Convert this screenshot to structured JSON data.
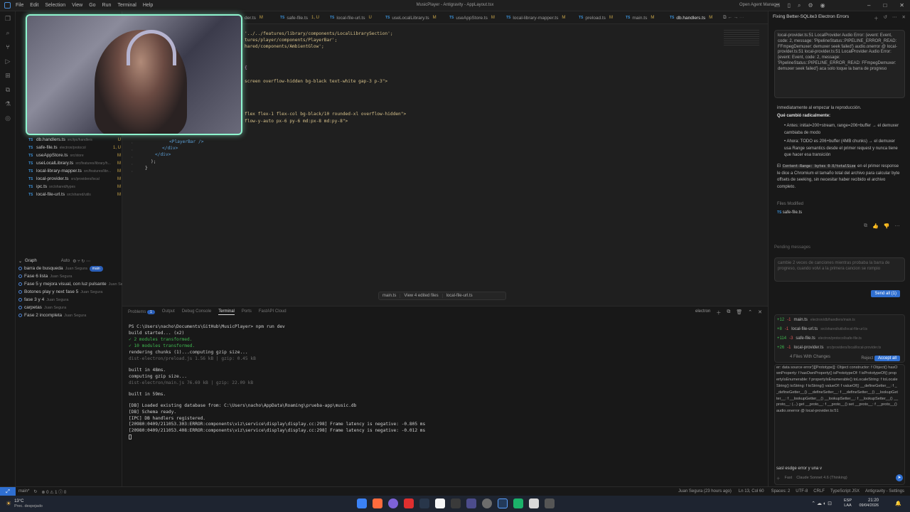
{
  "menubar": {
    "items": [
      "File",
      "Edit",
      "Selection",
      "View",
      "Go",
      "Run",
      "Terminal",
      "Help"
    ],
    "window_title": "MusicPlayer - Antigravity - AppLayout.tsx",
    "agent_manager": "Open Agent Manager"
  },
  "tabs": [
    {
      "name": "der.ts",
      "status": "M"
    },
    {
      "name": "safe-file.ts",
      "status": "1, U"
    },
    {
      "name": "local-file-url.ts",
      "status": "U"
    },
    {
      "name": "useLocalLibrary.ts",
      "status": "M"
    },
    {
      "name": "useAppStore.ts",
      "status": "M"
    },
    {
      "name": "local-library-mapper.ts",
      "status": "M"
    },
    {
      "name": "preload.ts",
      "status": "M"
    },
    {
      "name": "main.ts",
      "status": "M"
    },
    {
      "name": "db.handlers.ts",
      "status": "M"
    }
  ],
  "editor": {
    "lines": [
      {
        "text": "'../../features/library/components/LocalLibrarySection';"
      },
      {
        "text": "tures/player/components/PlayerBar';"
      },
      {
        "text": "hared/components/AmbientGlow';"
      },
      {
        "text": "{"
      },
      {
        "text": "screen overflow-hidden bg-black text-white gap-3 p-3\">"
      },
      {
        "text": "flex flex-1 flex-col bg-black/10 rounded-xl overflow-hidden\">"
      },
      {
        "text": "flow-y-auto px-6 py-6 md:px-8 md:py-8\">"
      }
    ],
    "lower_lines": [
      "<PlayerBar />",
      "</div>",
      "</div>",
      ");",
      "}"
    ]
  },
  "explorer_files": [
    {
      "name": "db.handlers.ts",
      "path": "src/ipc/handlers",
      "status": "U"
    },
    {
      "name": "safe-file.ts",
      "path": "electron/protocol",
      "status": "1, U"
    },
    {
      "name": "useAppStore.ts",
      "path": "src/store",
      "status": "M"
    },
    {
      "name": "useLocalLibrary.ts",
      "path": "src/features/library/h...",
      "status": "M"
    },
    {
      "name": "local-library-mapper.ts",
      "path": "src/features/libr...",
      "status": "M"
    },
    {
      "name": "local-provider.ts",
      "path": "src/providers/local",
      "status": "M"
    },
    {
      "name": "ipc.ts",
      "path": "src/shared/types",
      "status": "M"
    },
    {
      "name": "local-file-url.ts",
      "path": "src/shared/utils",
      "status": "M"
    }
  ],
  "graph": {
    "title": "Graph",
    "mode": "Auto",
    "commits": [
      {
        "label": "barra de busqueda",
        "author": "Juan Segura",
        "badge": "main"
      },
      {
        "label": "Fase 6 lista",
        "author": "Juan Segura"
      },
      {
        "label": "Fase 5 y mejora visual, con luz pulsante",
        "author": "Juan Segura"
      },
      {
        "label": "Botones play y next fase 5",
        "author": "Juan Segura"
      },
      {
        "label": "fase 3 y 4",
        "author": "Juan Segura"
      },
      {
        "label": "carpetas",
        "author": "Juan Segura"
      },
      {
        "label": "Fase 2 incompleta",
        "author": "Juan Segura"
      }
    ]
  },
  "diffbar": {
    "prev": "main.ts",
    "view": "View 4 edited files",
    "next": "local-file-url.ts"
  },
  "panel": {
    "tabs": [
      "Problems",
      "Output",
      "Debug Console",
      "Terminal",
      "Ports",
      "FastAPI Cloud"
    ],
    "problems_count": "1",
    "active_tab": "Terminal",
    "shell_label": "electron",
    "lines": [
      "PS C:\\Users\\nacho\\Documents\\GitHub\\MusicPlayer> npm run dev",
      "build started... (x2)",
      "✓ 2 modules transformed.",
      "✓ 10 modules transformed.",
      "rendering chunks (1)...computing gzip size...",
      "dist-electron/preload.js  1.56 kB | gzip: 0.45 kB",
      "",
      "built in 48ms.",
      "computing gzip size...",
      "dist-electron/main.js  76.69 kB | gzip: 22.09 kB",
      "",
      "built in 59ms.",
      "",
      "[DB] Loaded existing database from: C:\\Users\\nacho\\AppData\\Roaming\\prueba-app\\music.db",
      "[DB] Schema ready.",
      "[IPC] DB handlers registered.",
      "[20980:0409/211053.303:ERROR:components\\viz\\service\\display\\display.cc:298] Frame latency is negative: -0.805 ms",
      "[20980:0409/211053.408:ERROR:components\\viz\\service\\display\\display.cc:298] Frame latency is negative: -0.012 ms"
    ]
  },
  "agent": {
    "title": "Fixing Better-SQLite3 Electron Errors",
    "user_msg": "local-provider.ts:51 LocalProvider Audio Error: {event: Event, code: 2, message: 'PipelineStatus::PIPELINE_ERROR_READ: FFmpegDemuxer: demuxer seek failed'} audio.onerror @ local-provider.ts:51 local-provider.ts:51 LocalProvider Audio Error: {event: Event, code: 2, message: 'PipelineStatus::PIPELINE_ERROR_READ: FFmpegDemuxer: demuxer seek failed'} aca solo toque la barra de progreso",
    "reply_intro": "inmediatamente al empezar la reproducción.",
    "reply_heading": "Qué cambió radicalmente:",
    "bullets": [
      "Antes: initial=200+stream, range=206+buffer → el demuxer cambiaba de modo",
      "Ahora: TODO es 206+buffer (4MB chunks) → el demuxer usa Range semantics desde el primer request y nunca tiene que hacer esa transición"
    ],
    "para_pre": "El",
    "para_code": "Content-Range: bytes 0-X/totalSize",
    "para_post": "en el primer response le dice a Chromium el tamaño total del archivo para calcular byte offsets de seeking, sin necesitar haber recibido el archivo completo.",
    "files_modified_label": "Files Modified",
    "files_modified": [
      "safe-file.ts"
    ],
    "pending_label": "Pending messages",
    "pending_msg": "cambie 2 veces de canciones mientras probaba la barra de progreso, cuando volvi a la primera cancion se rompio",
    "send_all": "Send all (1)",
    "changes": [
      {
        "plus": "+12",
        "minus": "-1",
        "name": "main.ts",
        "path": "electron/db/handlers/main.ts"
      },
      {
        "plus": "+8",
        "minus": "-1",
        "name": "local-file-url.ts",
        "path": "src/shared/utils/local-file-url.ts"
      },
      {
        "plus": "+114",
        "minus": "-3",
        "name": "safe-file.ts",
        "path": "electron/protocol/safe-file.ts"
      },
      {
        "plus": "+26",
        "minus": "-1",
        "name": "local-provider.ts",
        "path": "src/providers/local/local-provider.ts"
      }
    ],
    "files_with_changes": "4 Files With Changes",
    "reject_all": "Reject all",
    "accept_all": "Accept all",
    "log_text": "local-provider.ts:51 LocalProvider Audio Error: {event: Event, code: 2, message: 'PipelineStatus::PIPELINE_ERROR_READ: FFmpegDemuxer: data source error'}[[Prototype]]: Object constructor: f Object() hasOwnProperty: f hasOwnProperty() isPrototypeOf: f isPrototypeOf() propertyIsEnumerable: f propertyIsEnumerable() toLocaleString: f toLocaleString() toString: f toString() valueOf: f valueOf() __defineGetter__: f __defineGetter__() __defineSetter__: f __defineSetter__() __lookupGetter__: f __lookupGetter__() __lookupSetter__: f __lookupSetter__() __proto__: (...) get __proto__: f __proto__() set __proto__: f __proto__() audio.onerror @ local-provider.ts:51",
    "draft": "sasl esdge error y una v",
    "model_label": "Claude Sonnet 4.6 (Thinking)",
    "fast_label": "Fast"
  },
  "status": {
    "branch": "main*",
    "errors": "0",
    "warnings": "1",
    "info": "0",
    "blame": "Juan Segura (23 hours ago)",
    "position": "Ln 13, Col 60",
    "spaces": "Spaces: 2",
    "encoding": "UTF-8",
    "eol": "CRLF",
    "language": "TypeScript JSX",
    "settings": "Antigravity - Settings"
  },
  "taskbar": {
    "temp": "13°C",
    "weather": "Prec. despejado",
    "lang1": "ESP",
    "lang2": "LAA",
    "time": "21:20",
    "date": "09/04/2026"
  }
}
